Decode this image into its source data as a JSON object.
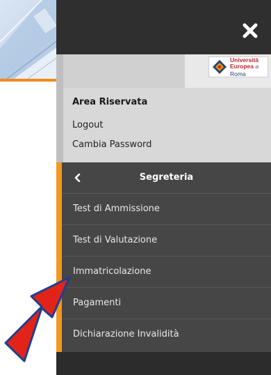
{
  "logo": {
    "line1": "Università",
    "line2": "Europea",
    "line2_suffix": "di",
    "line3": "Roma"
  },
  "user_section": {
    "title": "Area Riservata",
    "links": [
      "Logout",
      "Cambia Password"
    ]
  },
  "menu": {
    "header": "Segreteria",
    "items": [
      "Test di Ammissione",
      "Test di Valutazione",
      "Immatricolazione",
      "Pagamenti",
      "Dichiarazione Invalidità"
    ]
  },
  "icons": {
    "close": "close-icon",
    "back": "chevron-left-icon",
    "pointer": "red-arrow-annotation"
  },
  "colors": {
    "accent": "#f2981f",
    "drawer": "#464646",
    "arrow": "#e2231a"
  }
}
